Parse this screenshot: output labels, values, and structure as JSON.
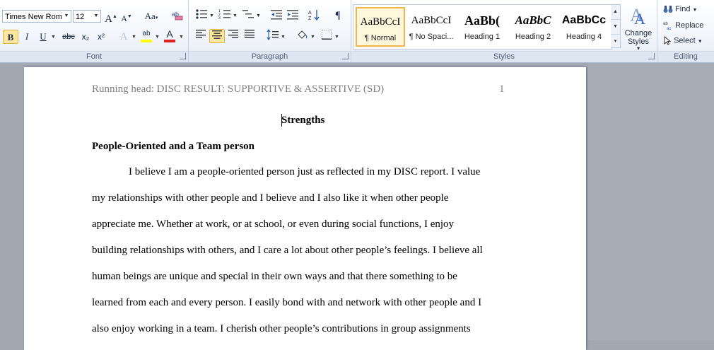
{
  "ribbon": {
    "font_group": {
      "label": "Font",
      "font_name": "Times New Rom",
      "font_size": "12",
      "grow_label": "A",
      "shrink_label": "A",
      "case_label": "Aa",
      "bold": "B",
      "italic": "I",
      "underline": "U",
      "strikethrough": "abc",
      "subscript": "x₂",
      "superscript": "x²",
      "effects": "A",
      "highlight": "ab",
      "font_color": "A"
    },
    "paragraph_group": {
      "label": "Paragraph",
      "show_marks": "¶"
    },
    "styles_group": {
      "label": "Styles",
      "tiles": [
        {
          "preview": "AaBbCcI",
          "name": "¶ Normal"
        },
        {
          "preview": "AaBbCcI",
          "name": "¶ No Spaci..."
        },
        {
          "preview": "AaBb(",
          "name": "Heading 1"
        },
        {
          "preview": "AaBbC",
          "name": "Heading 2"
        },
        {
          "preview": "AaBbCc",
          "name": "Heading 4"
        }
      ],
      "change_styles": "Change Styles",
      "change_styles_arrow": "▾"
    },
    "editing_group": {
      "label": "Editing",
      "find": "Find",
      "replace": "Replace",
      "select": "Select"
    }
  },
  "document": {
    "header_text": "Running head: DISC RESULT: SUPPORTIVE & ASSERTIVE (SD)",
    "page_number": "1",
    "title": "Strengths",
    "subheading": "People-Oriented  and a Team person",
    "lines": [
      "I believe  I am a people-oriented person just as reflected in my DISC report. I value",
      "my relationships  with other people and I believe and I also like it when other people",
      "appreciate me. Whether at work, or at school, or even during social functions, I enjoy",
      "building relationships  with others, and I care a lot about other people’s  feelings. I believe all",
      "human beings are unique and special in their own ways and that there something to be",
      "learned from each and every person.  I easily  bond with and network with other people and I",
      "also enjoy working in a team. I cherish other people’s  contributions in group assignments"
    ]
  },
  "colors": {
    "workspace": "#a2a8b1",
    "active_button": "#fce7a1",
    "font_color_bar": "#e02020",
    "highlight_bar": "#ffff00"
  }
}
